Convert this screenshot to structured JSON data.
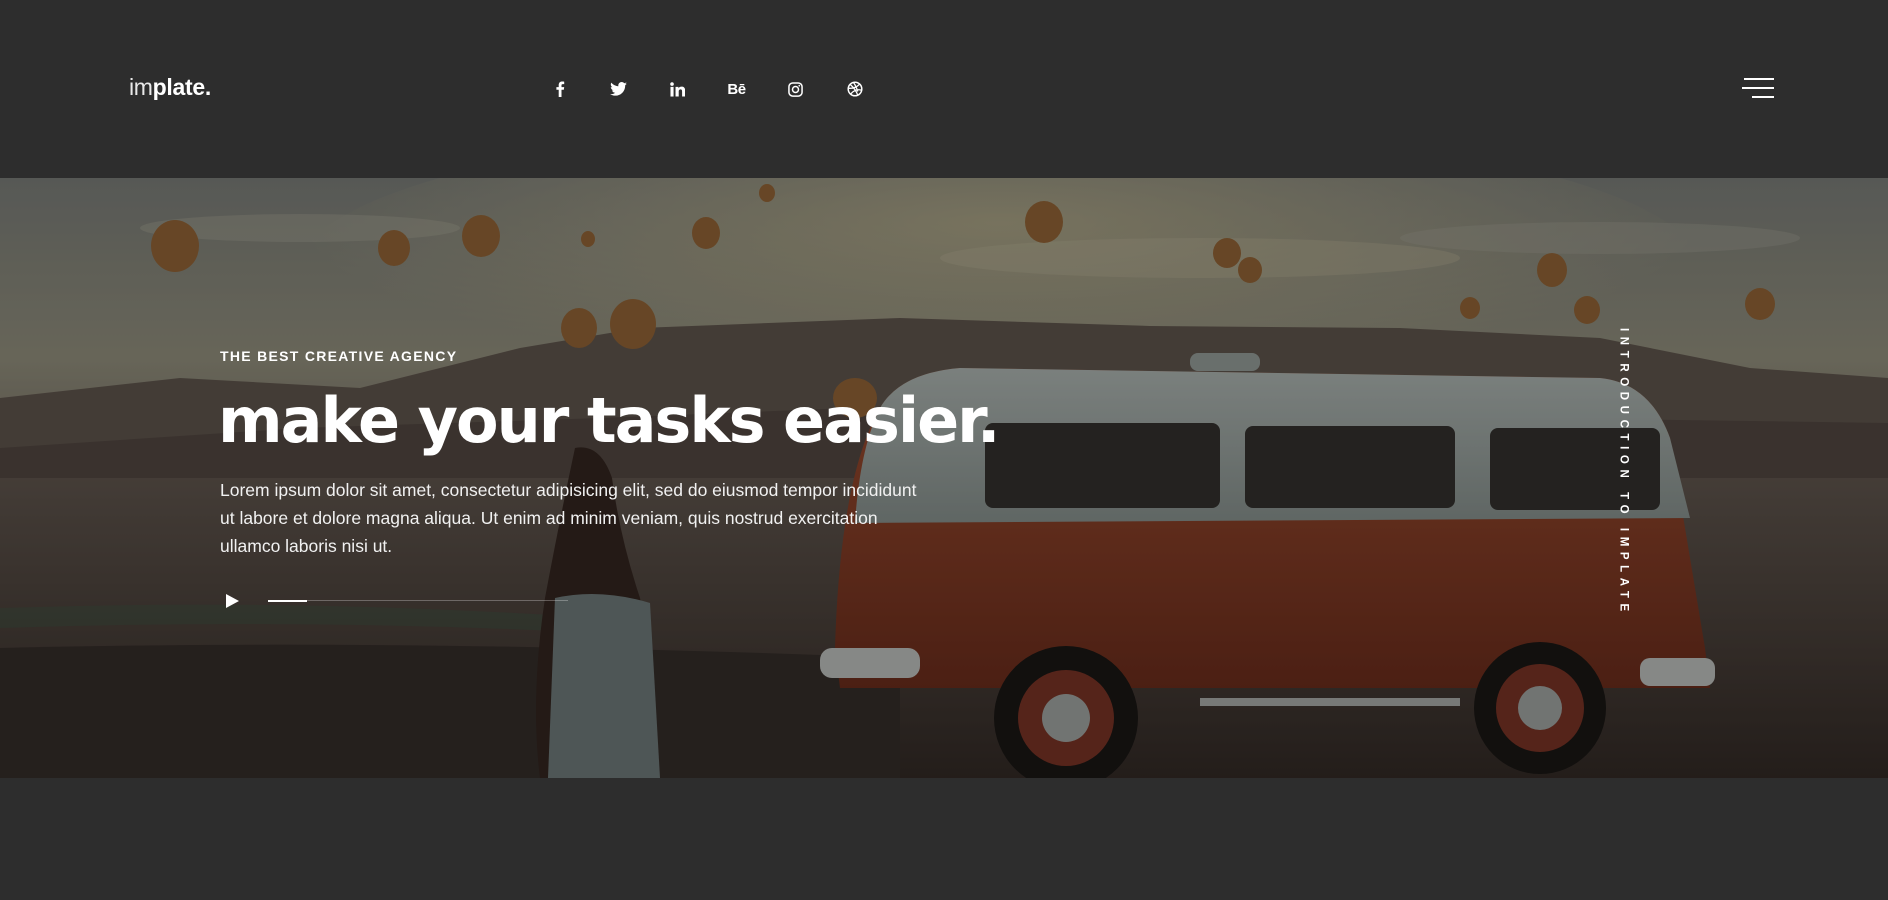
{
  "header": {
    "logo_light": "im",
    "logo_bold": "plate.",
    "socials": [
      "facebook-icon",
      "twitter-icon",
      "linkedin-icon",
      "behance-icon",
      "instagram-icon",
      "dribbble-icon"
    ],
    "behance_glyph": "Bē",
    "menu_icon": "hamburger-menu-icon"
  },
  "hero": {
    "eyebrow": "THE BEST CREATIVE AGENCY",
    "title": "make your tasks easier.",
    "description": "Lorem ipsum dolor sit amet, consectetur adipisicing elit, sed do eiusmod tempor incididunt ut labore et dolore magna aliqua. Ut enim ad minim veniam, quis nostrud exercitation ullamco laboris nisi ut.",
    "play_icon": "play-icon",
    "video_progress": 0.13,
    "side_label": "INTRODUCTION TO IMPLATE"
  },
  "colors": {
    "page_bg": "#2d2d2d",
    "text": "#ffffff",
    "van": "#a84a2e"
  }
}
